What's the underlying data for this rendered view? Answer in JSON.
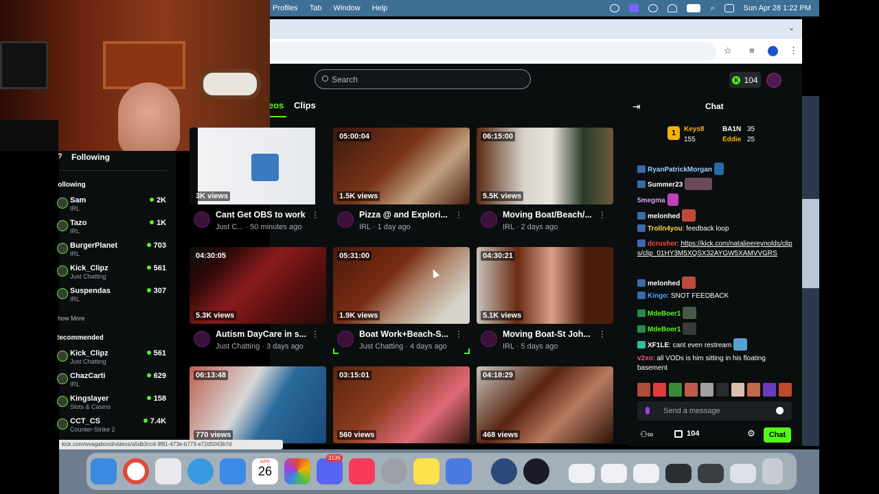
{
  "menubar": {
    "items": [
      "Profiles",
      "Tab",
      "Window",
      "Help"
    ],
    "datetime": "Sun Apr 28  1:22 PM"
  },
  "header": {
    "search_placeholder": "Search",
    "kicks_count": "104"
  },
  "tabs": {
    "videos": "Videos",
    "clips": "Clips"
  },
  "sidebar": {
    "following_title": "Following",
    "following_header": "Following",
    "following": [
      {
        "name": "Sam",
        "category": "IRL",
        "viewers": "2K"
      },
      {
        "name": "Tazo",
        "category": "IRL",
        "viewers": "1K"
      },
      {
        "name": "BurgerPlanet",
        "category": "IRL",
        "viewers": "703"
      },
      {
        "name": "Kick_Clipz",
        "category": "Just Chatting",
        "viewers": "561"
      },
      {
        "name": "Suspendas",
        "category": "IRL",
        "viewers": "307"
      }
    ],
    "show_more": "Show More",
    "recommended_header": "Recommended",
    "recommended": [
      {
        "name": "Kick_Clipz",
        "category": "Just Chatting",
        "viewers": "561"
      },
      {
        "name": "ChazCarti",
        "category": "IRL",
        "viewers": "629"
      },
      {
        "name": "Kingslayer",
        "category": "Slots & Casino",
        "viewers": "158"
      },
      {
        "name": "CCT_CS",
        "category": "Counter-Strike 2",
        "viewers": "7.4K"
      }
    ]
  },
  "videos": [
    {
      "duration": "",
      "views": "3K views",
      "title": "Cant Get OBS to work",
      "sub": "Just C... · 50 minutes ago"
    },
    {
      "duration": "05:00:04",
      "views": "1.5K views",
      "title": "Pizza @ and Explori...",
      "sub": "IRL · 1 day ago"
    },
    {
      "duration": "06:15:00",
      "views": "5.5K views",
      "title": "Moving Boat/Beach/...",
      "sub": "IRL · 2 days ago"
    },
    {
      "duration": "04:30:05",
      "views": "5.3K views",
      "title": "Autism DayCare in s...",
      "sub": "Just Chatting · 3 days ago"
    },
    {
      "duration": "05:31:00",
      "views": "1.9K views",
      "title": "Boat Work+Beach-S...",
      "sub": "Just Chatting · 4 days ago"
    },
    {
      "duration": "04:30:21",
      "views": "5.1K views",
      "title": "Moving Boat-St Joh...",
      "sub": "IRL · 5 days ago"
    },
    {
      "duration": "06:13:48",
      "views": "770 views",
      "title": "",
      "sub": ""
    },
    {
      "duration": "03:15:01",
      "views": "560 views",
      "title": "",
      "sub": ""
    },
    {
      "duration": "04:18:29",
      "views": "468 views",
      "title": "",
      "sub": ""
    }
  ],
  "chat": {
    "title": "Chat",
    "leaderboard": [
      {
        "name": "Keys8",
        "amount": "155"
      },
      {
        "name": "BA1N",
        "amount": "35"
      },
      {
        "name": "Eddie",
        "amount": "25"
      }
    ],
    "messages": [
      {
        "user": "RyanPatrickMorgan",
        "text": ""
      },
      {
        "user": "Summer23",
        "text": ""
      },
      {
        "user": "5megma",
        "text": ""
      },
      {
        "user": "melonhed",
        "text": ""
      },
      {
        "user": "Trolln4you",
        "text": "feedback loop"
      },
      {
        "user": "dcrusher",
        "text": "https://kick.com/natalieereynolds/clips/clip_01HY3M5XQSX32AYGW5XAMVVGRS"
      },
      {
        "user": "melonhed",
        "text": ""
      },
      {
        "user": "Kingo",
        "text": "SNOT FEEDBACK"
      },
      {
        "user": "MdeBoer1",
        "text": ""
      },
      {
        "user": "MdeBoer1",
        "text": ""
      },
      {
        "user": "XF1LE",
        "text": "cant even restream"
      },
      {
        "user": "v2xo",
        "text": "all VODs is him sitting in his floating basement"
      }
    ],
    "input_placeholder": "Send a message",
    "points": "104",
    "send_label": "Chat"
  },
  "status_url": "kick.com/wvagabond/videos/a5db3ccd-9f81-473e-b773-e72d5043b7d",
  "dock": {
    "calendar_month": "APR",
    "calendar_day": "26",
    "discord_badge": "3136"
  },
  "colors": {
    "accent": "#53fc18",
    "page_bg": "#0b0e0f",
    "menubar": "#3e6f95"
  }
}
